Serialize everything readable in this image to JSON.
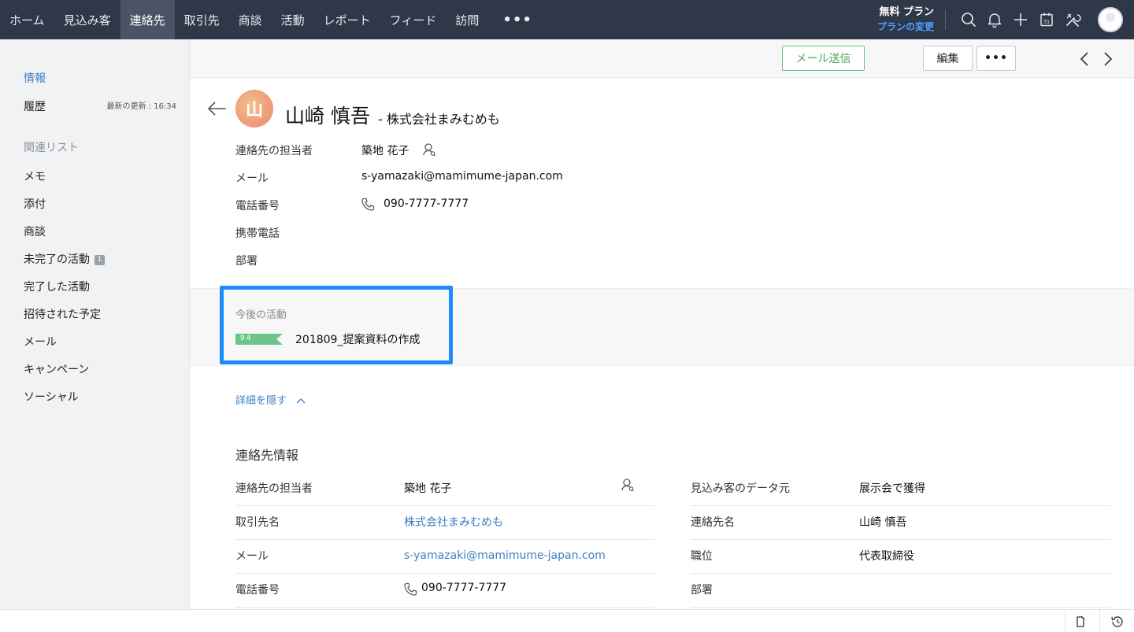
{
  "nav": {
    "tabs": [
      "ホーム",
      "見込み客",
      "連絡先",
      "取引先",
      "商談",
      "活動",
      "レポート",
      "フィード",
      "訪問"
    ],
    "active_index": 2,
    "more": "•••",
    "plan_name": "無料 プラン",
    "plan_link": "プランの変更",
    "icons": [
      "search-icon",
      "bell-icon",
      "plus-icon",
      "calendar-icon",
      "tools-icon",
      "avatar"
    ]
  },
  "sidebar": {
    "info": "情報",
    "history": "履歴",
    "updated": "最新の更新 : 16:34",
    "related_header": "関連リスト",
    "items": [
      "メモ",
      "添付",
      "商談",
      "未完了の活動",
      "完了した活動",
      "招待された予定",
      "メール",
      "キャンペーン",
      "ソーシャル"
    ],
    "badge": "1"
  },
  "actions": {
    "send_mail": "メール送信",
    "edit": "編集",
    "more": "•••"
  },
  "record": {
    "avatar_initial": "山",
    "name": "山崎 慎吾",
    "company": "- 株式会社まみむめも",
    "owner_label": "連絡先の担当者",
    "owner_value": "築地 花子",
    "email_label": "メール",
    "email_value": "s-yamazaki@mamimume-japan.com",
    "phone_label": "電話番号",
    "phone_value": "090-7777-7777",
    "mobile_label": "携帯電話",
    "dept_label": "部署"
  },
  "upcoming": {
    "title": "今後の活動",
    "flag": "94",
    "item": "201809_提案資料の作成"
  },
  "hide_details": "詳細を隠す",
  "contact_info": {
    "title": "連絡先情報",
    "left": [
      {
        "label": "連絡先の担当者",
        "value": "築地 花子"
      },
      {
        "label": "取引先名",
        "value": "株式会社まみむめも"
      },
      {
        "label": "メール",
        "value": "s-yamazaki@mamimume-japan.com"
      },
      {
        "label": "電話番号",
        "value": "090-7777-7777"
      }
    ],
    "right": [
      {
        "label": "見込み客のデータ元",
        "value": "展示会で獲得"
      },
      {
        "label": "連絡先名",
        "value": "山崎 慎吾"
      },
      {
        "label": "職位",
        "value": "代表取締役"
      },
      {
        "label": "部署",
        "value": ""
      }
    ]
  },
  "colors": {
    "nav_bg": "#2f3848",
    "link": "#3b7fc4",
    "highlight": "#1a8cff",
    "mail_button": "#4aa65a",
    "flag": "#6cc58a"
  }
}
